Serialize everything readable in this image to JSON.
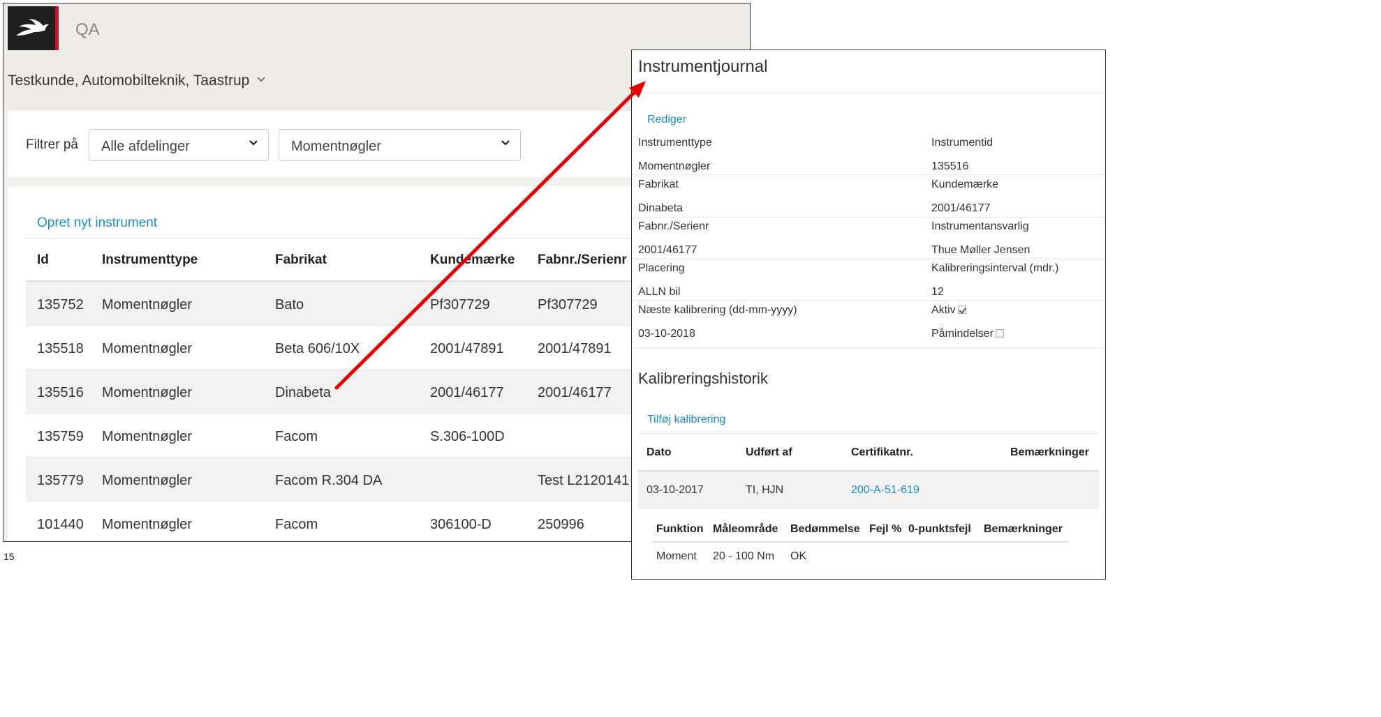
{
  "app": {
    "title": "QA",
    "customer": "Testkunde, Automobilteknik, Taastrup"
  },
  "filter": {
    "label": "Filtrer på",
    "department": "Alle afdelinger",
    "instrument_type": "Momentnøgler"
  },
  "list": {
    "create_link": "Opret nyt instrument",
    "columns": [
      "Id",
      "Instrumenttype",
      "Fabrikat",
      "Kundemærke",
      "Fabnr./Serienr"
    ],
    "rows": [
      [
        "135752",
        "Momentnøgler",
        "Bato",
        "Pf307729",
        "Pf307729"
      ],
      [
        "135518",
        "Momentnøgler",
        "Beta 606/10X",
        "2001/47891",
        "2001/47891"
      ],
      [
        "135516",
        "Momentnøgler",
        "Dinabeta",
        "2001/46177",
        "2001/46177"
      ],
      [
        "135759",
        "Momentnøgler",
        "Facom",
        "S.306-100D",
        ""
      ],
      [
        "135779",
        "Momentnøgler",
        "Facom R.304 DA",
        "",
        "Test L2120141"
      ],
      [
        "101440",
        "Momentnøgler",
        "Facom",
        "306100-D",
        "250996"
      ]
    ]
  },
  "page_number": "15",
  "detail": {
    "title": "Instrumentjournal",
    "edit_link": "Rediger",
    "fields": {
      "type_label": "Instrumenttype",
      "type_value": "Momentnøgler",
      "id_label": "Instrumentid",
      "id_value": "135516",
      "make_label": "Fabrikat",
      "make_value": "Dinabeta",
      "mark_label": "Kundemærke",
      "mark_value": "2001/46177",
      "serial_label": "Fabnr./Serienr",
      "serial_value": "2001/46177",
      "owner_label": "Instrumentansvarlig",
      "owner_value": "Thue Møller Jensen",
      "place_label": "Placering",
      "place_value": "ALLN bil",
      "interval_label": "Kalibreringsinterval (mdr.)",
      "interval_value": "12",
      "next_label": "Næste kalibrering (dd-mm-yyyy)",
      "next_value": "03-10-2018",
      "active_label": "Aktiv",
      "reminders_label": "Påmindelser"
    },
    "active_checked": true,
    "reminders_checked": false,
    "history_title": "Kalibreringshistorik",
    "add_link": "Tilføj kalibrering",
    "history_columns": [
      "Dato",
      "Udført af",
      "Certifikatnr.",
      "Bemærkninger"
    ],
    "history_rows": [
      {
        "date": "03-10-2017",
        "by": "TI, HJN",
        "cert": "200-A-51-619",
        "notes": ""
      }
    ],
    "sub_columns": [
      "Funktion",
      "Måleområde",
      "Bedømmelse",
      "Fejl %",
      "0-punktsfejl",
      "Bemærkninger"
    ],
    "sub_rows": [
      [
        "Moment",
        "20 - 100 Nm",
        "OK",
        "",
        "",
        ""
      ]
    ]
  },
  "colors": {
    "link": "#1a8cd8",
    "arrow": "#e60000",
    "logo_accent": "#c8102e"
  }
}
